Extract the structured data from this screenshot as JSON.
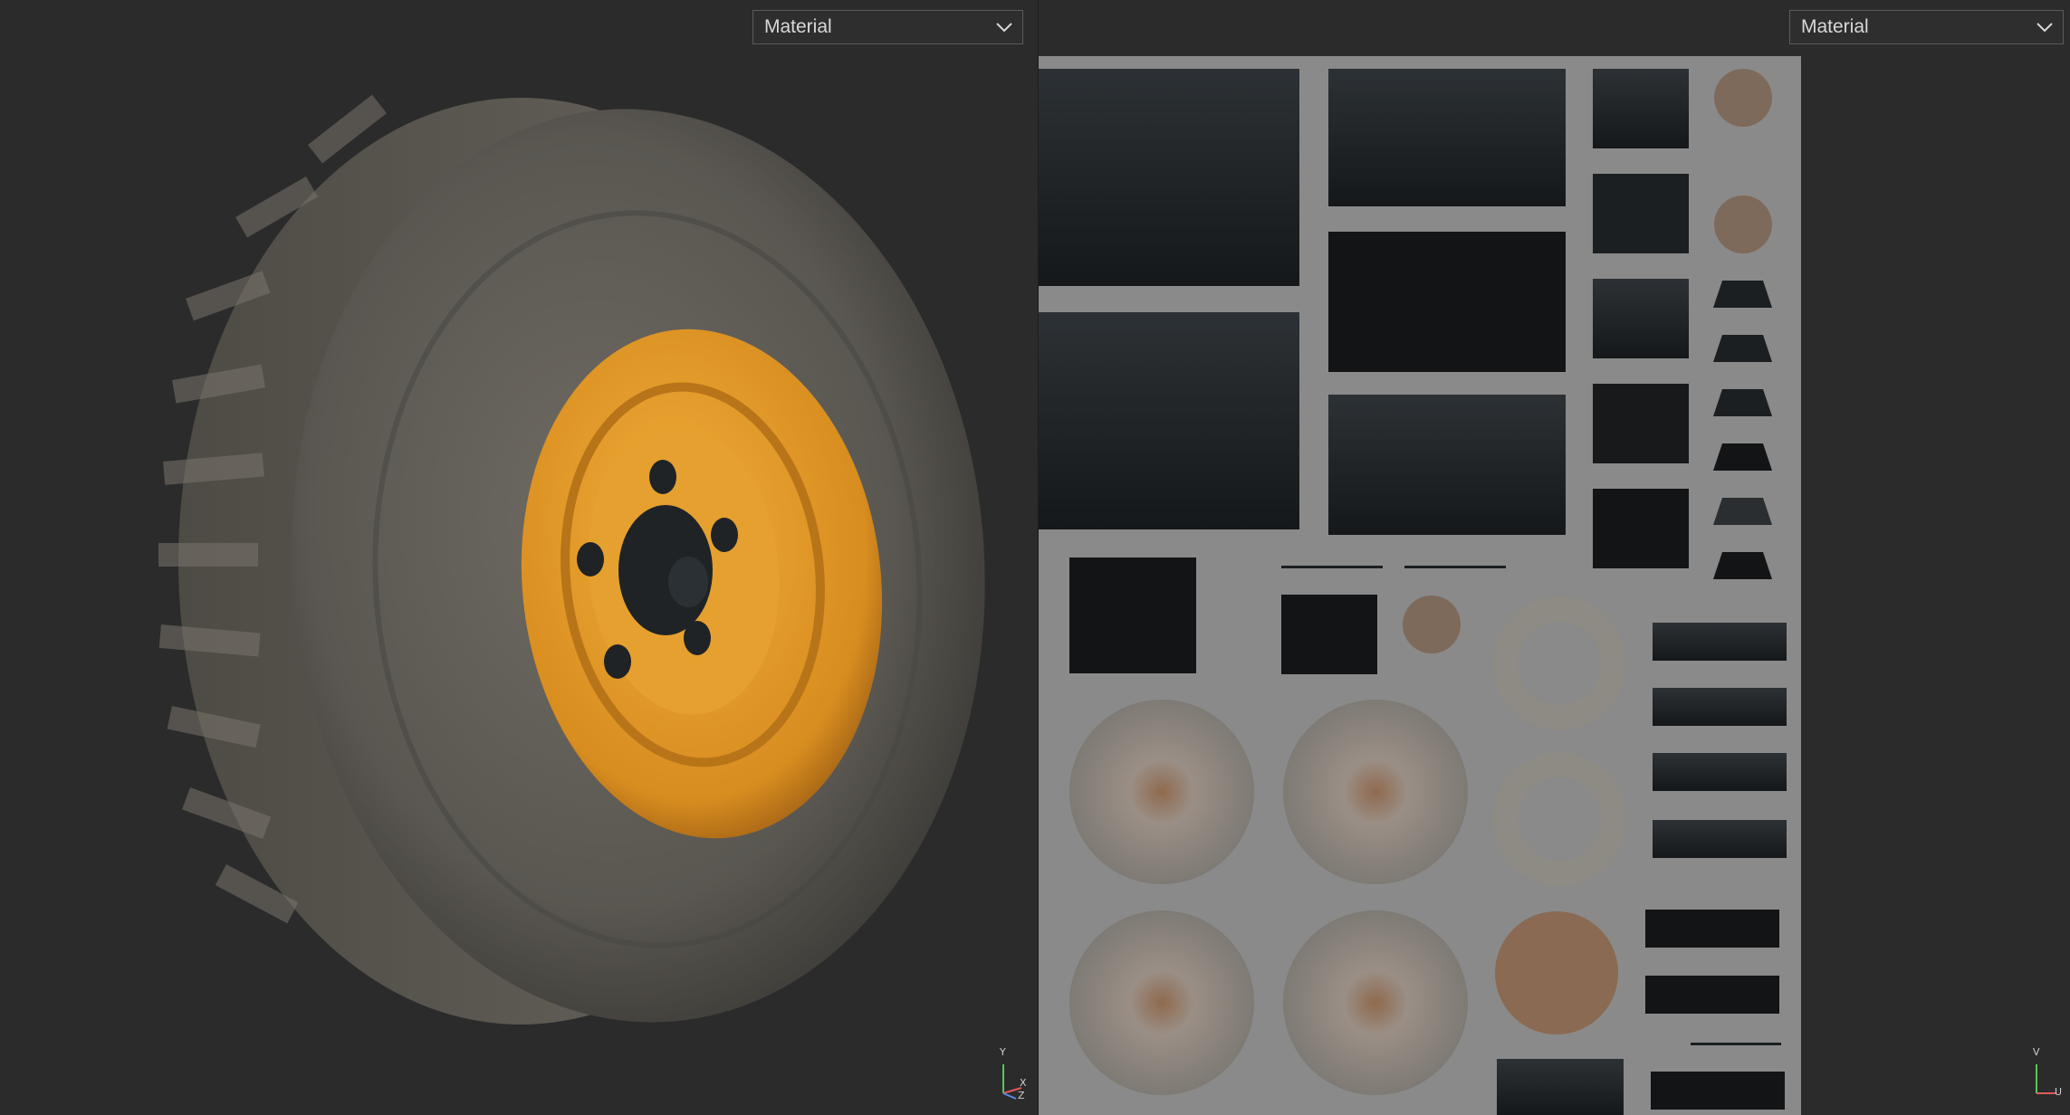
{
  "viewport_3d": {
    "channel_dropdown": {
      "selected": "Material"
    },
    "axis_gizmo": {
      "labels": [
        "Y",
        "X",
        "Z"
      ]
    }
  },
  "viewport_uv": {
    "channel_dropdown": {
      "selected": "Material"
    },
    "axis_gizmo": {
      "labels": [
        "V",
        "U"
      ]
    }
  },
  "icons": {
    "dropdown": "chevron-down-icon",
    "axis": "axis-gizmo-icon"
  },
  "colors": {
    "viewport_bg": "#2b2b2b",
    "uv_sheet_bg": "#8a8a8a",
    "rim": "#e09a2a",
    "tire": "#5e5b55",
    "metal": "#9a9690",
    "rust": "#8a4a22",
    "dark_metal": "#1f2326"
  }
}
